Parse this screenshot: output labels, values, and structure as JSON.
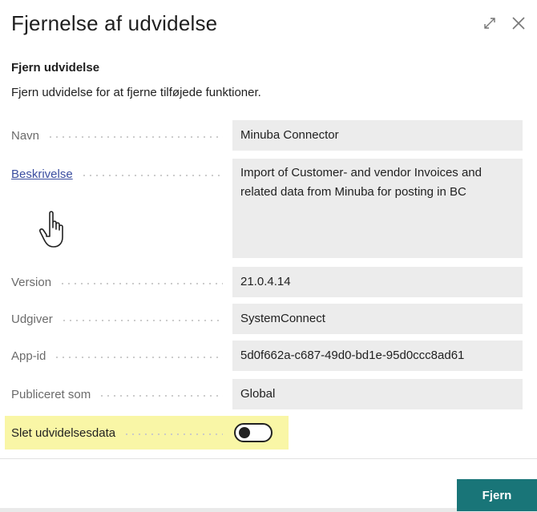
{
  "dialog": {
    "title": "Fjernelse af udvidelse",
    "section_title": "Fjern udvidelse",
    "section_desc": "Fjern udvidelse for at fjerne tilføjede funktioner."
  },
  "fields": {
    "name": {
      "label": "Navn",
      "value": "Minuba Connector"
    },
    "description": {
      "label": "Beskrivelse",
      "value": "Import of Customer- and vendor Invoices and related data from Minuba for posting in BC"
    },
    "version": {
      "label": "Version",
      "value": "21.0.4.14"
    },
    "publisher": {
      "label": "Udgiver",
      "value": "SystemConnect"
    },
    "app_id": {
      "label": "App-id",
      "value": "5d0f662a-c687-49d0-bd1e-95d0ccc8ad61"
    },
    "published_as": {
      "label": "Publiceret som",
      "value": "Global"
    },
    "delete_data": {
      "label": "Slet udvidelsesdata",
      "toggle_on": false
    }
  },
  "actions": {
    "remove_label": "Fjern"
  },
  "icons": {
    "expand": "expand-icon",
    "close": "close-icon",
    "cursor": "hand-pointer-icon"
  },
  "colors": {
    "accent": "#197578",
    "highlight": "#f9f6a6",
    "link": "#3b4ea0"
  }
}
